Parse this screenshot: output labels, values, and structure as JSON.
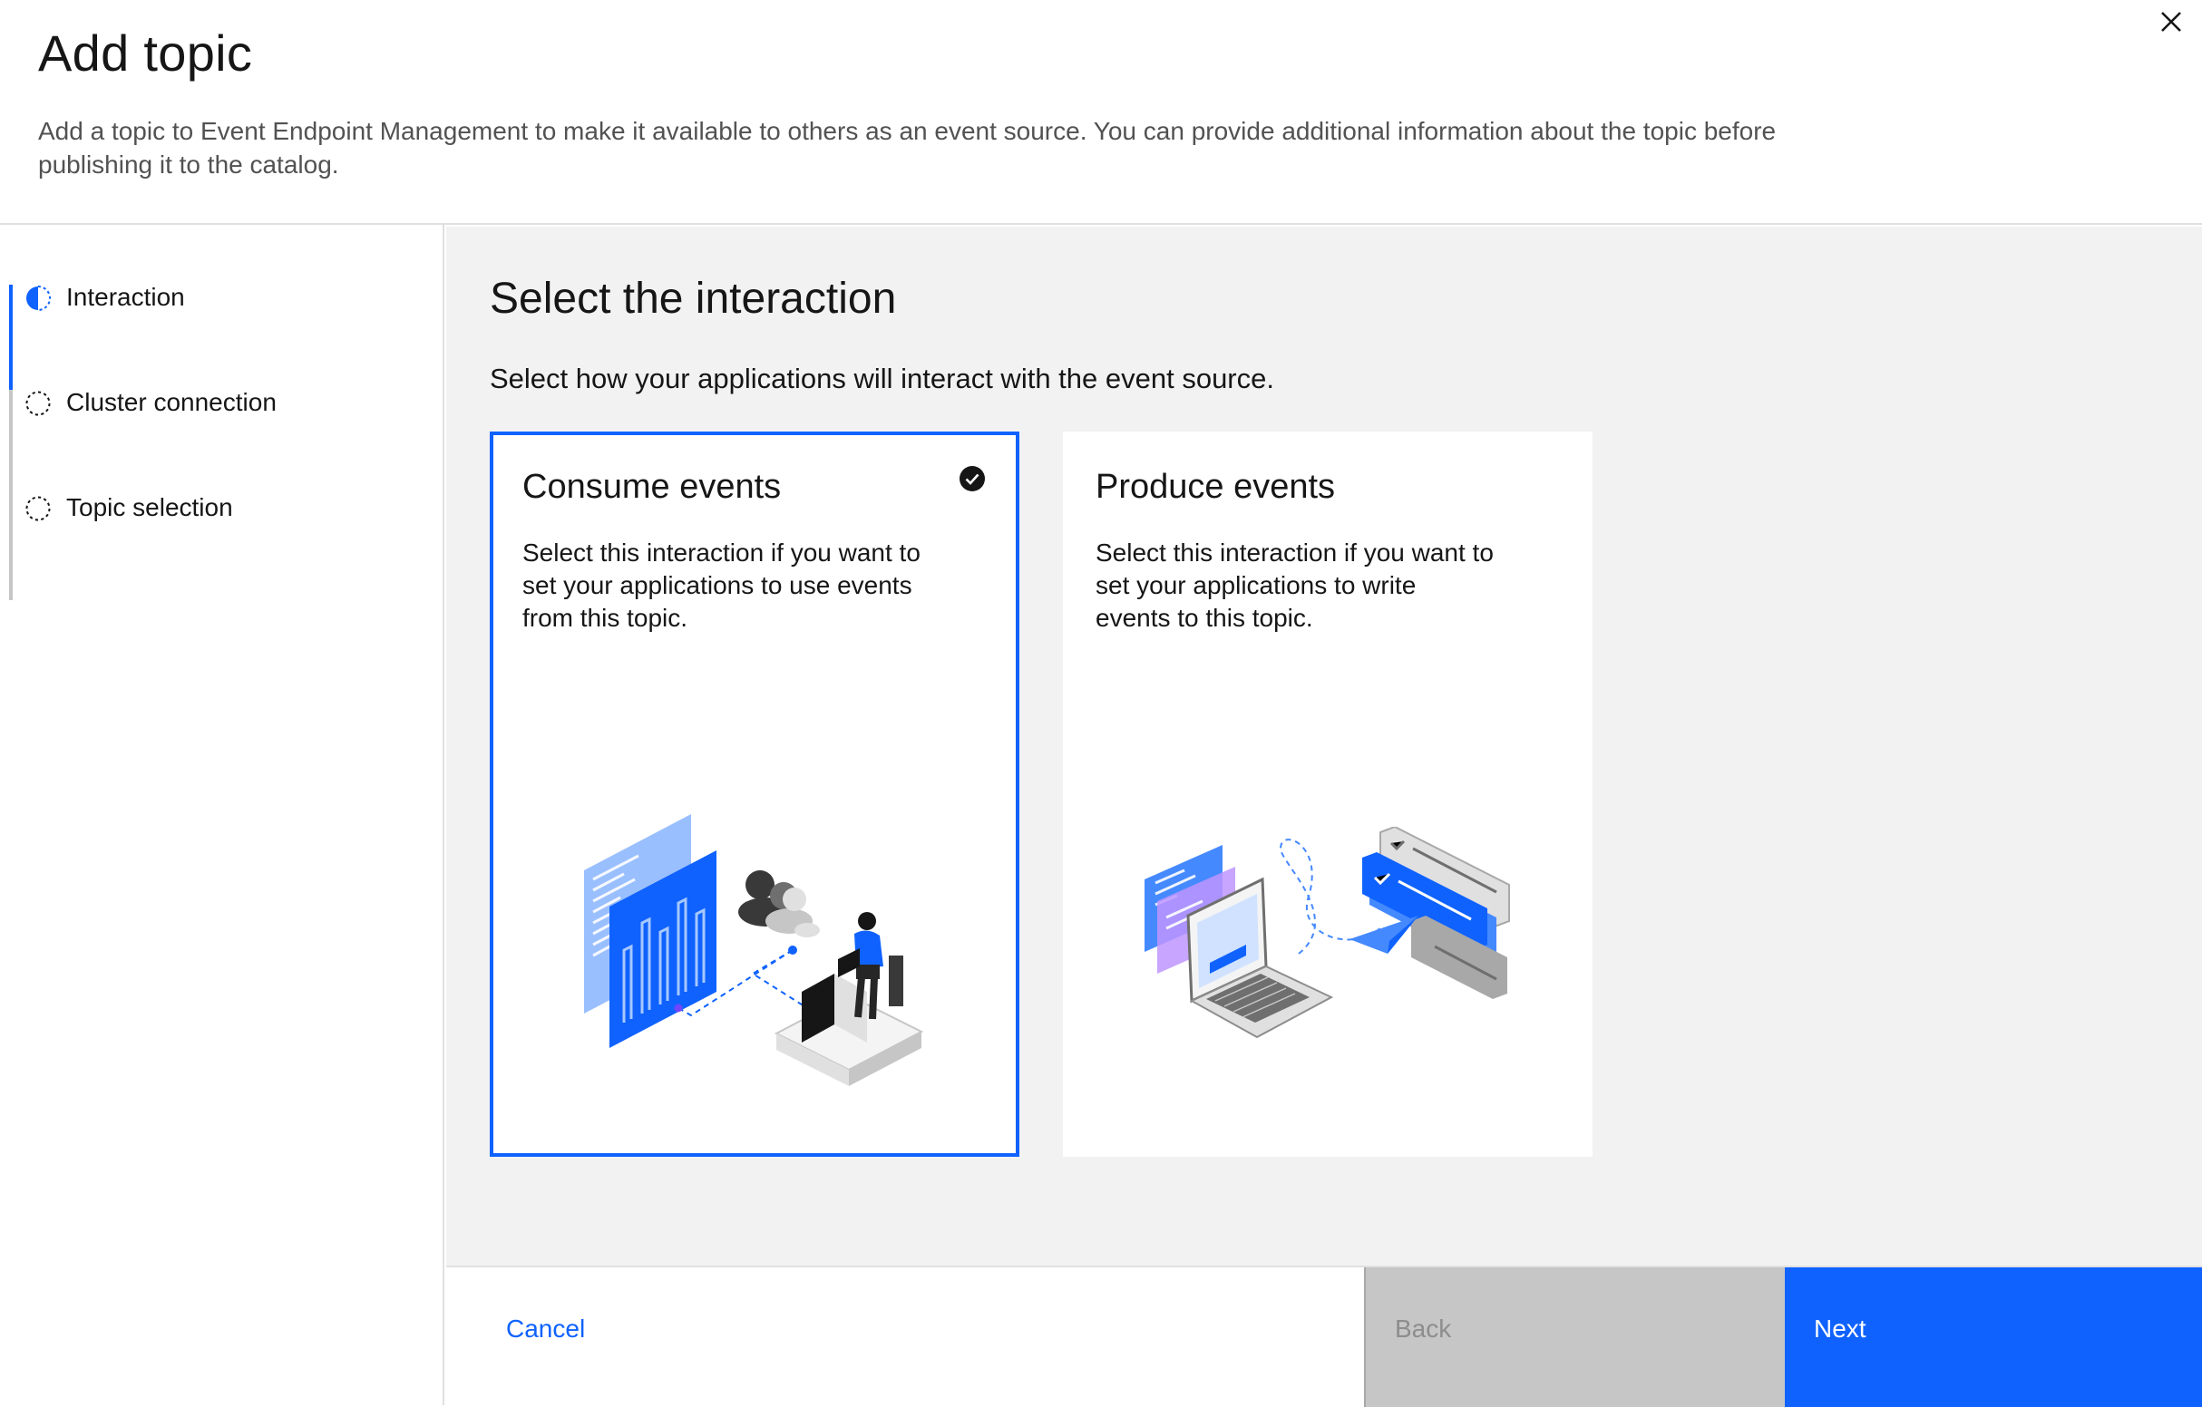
{
  "header": {
    "title": "Add topic",
    "description": "Add a topic to Event Endpoint Management to make it available to others as an event source. You can provide additional information about the topic before publishing it to the catalog.",
    "close_icon": "close-icon"
  },
  "progress": {
    "steps": [
      {
        "label": "Interaction",
        "state": "current",
        "icon": "half-filled-circle-icon"
      },
      {
        "label": "Cluster connection",
        "state": "incomplete",
        "icon": "dashed-circle-icon"
      },
      {
        "label": "Topic selection",
        "state": "incomplete",
        "icon": "dashed-circle-icon"
      }
    ]
  },
  "main": {
    "title": "Select the interaction",
    "subtitle": "Select how your applications will interact with the event source.",
    "tiles": [
      {
        "title": "Consume events",
        "description": "Select this interaction if you want to set your applications to use events from this topic.",
        "selected": true,
        "check_icon": "checkmark-filled-icon"
      },
      {
        "title": "Produce events",
        "description": "Select this interaction if you want to set your applications to write events to this topic.",
        "selected": false
      }
    ]
  },
  "footer": {
    "cancel_label": "Cancel",
    "back_label": "Back",
    "next_label": "Next"
  },
  "colors": {
    "primary": "#0f62fe",
    "panel_bg": "#f2f2f2",
    "disabled_bg": "#c6c6c6",
    "text": "#161616"
  }
}
